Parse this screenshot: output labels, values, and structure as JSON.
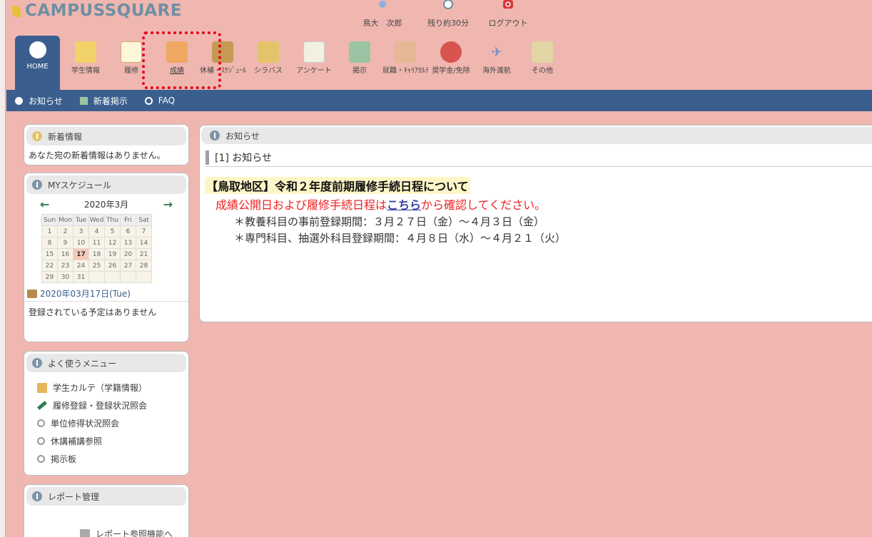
{
  "app": {
    "logo": "CAMPUSSQUARE"
  },
  "userbar": {
    "user": "鳥大　次郎",
    "remaining": "残り約30分",
    "logout": "ログアウト"
  },
  "nav": [
    {
      "label": "HOME"
    },
    {
      "label": "学生情報"
    },
    {
      "label": "履修"
    },
    {
      "label": "成績"
    },
    {
      "label": "休補・ｽｹｼﾞｭｰﾙ"
    },
    {
      "label": "シラバス"
    },
    {
      "label": "アンケート"
    },
    {
      "label": "掲示"
    },
    {
      "label": "就職・ｷｬﾘｱｶﾙﾃ"
    },
    {
      "label": "奨学金/免除"
    },
    {
      "label": "海外渡航"
    },
    {
      "label": "その他"
    }
  ],
  "subbar": {
    "oshirase": "お知らせ",
    "shinchaku": "新着掲示",
    "faq": "FAQ"
  },
  "news_panel": {
    "title": "新着情報",
    "body": "あなた宛の新着情報はありません。"
  },
  "schedule_panel": {
    "title": "MYスケジュール",
    "month": "2020年3月",
    "prev": "←",
    "next": "→",
    "weekdays": [
      "Sun",
      "Mon",
      "Tue",
      "Wed",
      "Thu",
      "Fri",
      "Sat"
    ],
    "weeks": [
      [
        "1",
        "2",
        "3",
        "4",
        "5",
        "6",
        "7"
      ],
      [
        "8",
        "9",
        "10",
        "11",
        "12",
        "13",
        "14"
      ],
      [
        "15",
        "16",
        "17",
        "18",
        "19",
        "20",
        "21"
      ],
      [
        "22",
        "23",
        "24",
        "25",
        "26",
        "27",
        "28"
      ],
      [
        "29",
        "30",
        "31",
        "",
        "",
        "",
        ""
      ]
    ],
    "today": "17",
    "selected_date": "2020年03月17日(Tue)",
    "no_plans": "登録されている予定はありません"
  },
  "menu_panel": {
    "title": "よく使うメニュー",
    "items": [
      {
        "label": "学生カルテ（学籍情報）",
        "icon": "student-icon"
      },
      {
        "label": "履修登録・登録状況照会",
        "icon": "pencil-icon"
      },
      {
        "label": "単位修得状況照会",
        "icon": "magnifier-icon"
      },
      {
        "label": "休講補講参照",
        "icon": "magnifier-icon"
      },
      {
        "label": "掲示板",
        "icon": "magnifier-icon"
      }
    ]
  },
  "report_panel": {
    "title": "レポート管理",
    "link": "レポート参照機能へ"
  },
  "main": {
    "header": "お知らせ",
    "section": "[1] お知らせ",
    "notice_title": "【鳥取地区】令和２年度前期履修手続日程について",
    "notice_red_before": "成績公開日および履修手続日程は",
    "notice_link": "こちら",
    "notice_red_after": "から確認してください。",
    "items": [
      "＊教養科目の事前登録期間：３月２７日（金）～４月３日（金）",
      "＊専門科目、抽選外科目登録期間：４月８日（水）～４月２１（火）"
    ]
  },
  "colors": {
    "navy": "#3a5f8e",
    "background": "#efb7b0",
    "highlight": "#e6001b",
    "red_text": "#e22222"
  }
}
